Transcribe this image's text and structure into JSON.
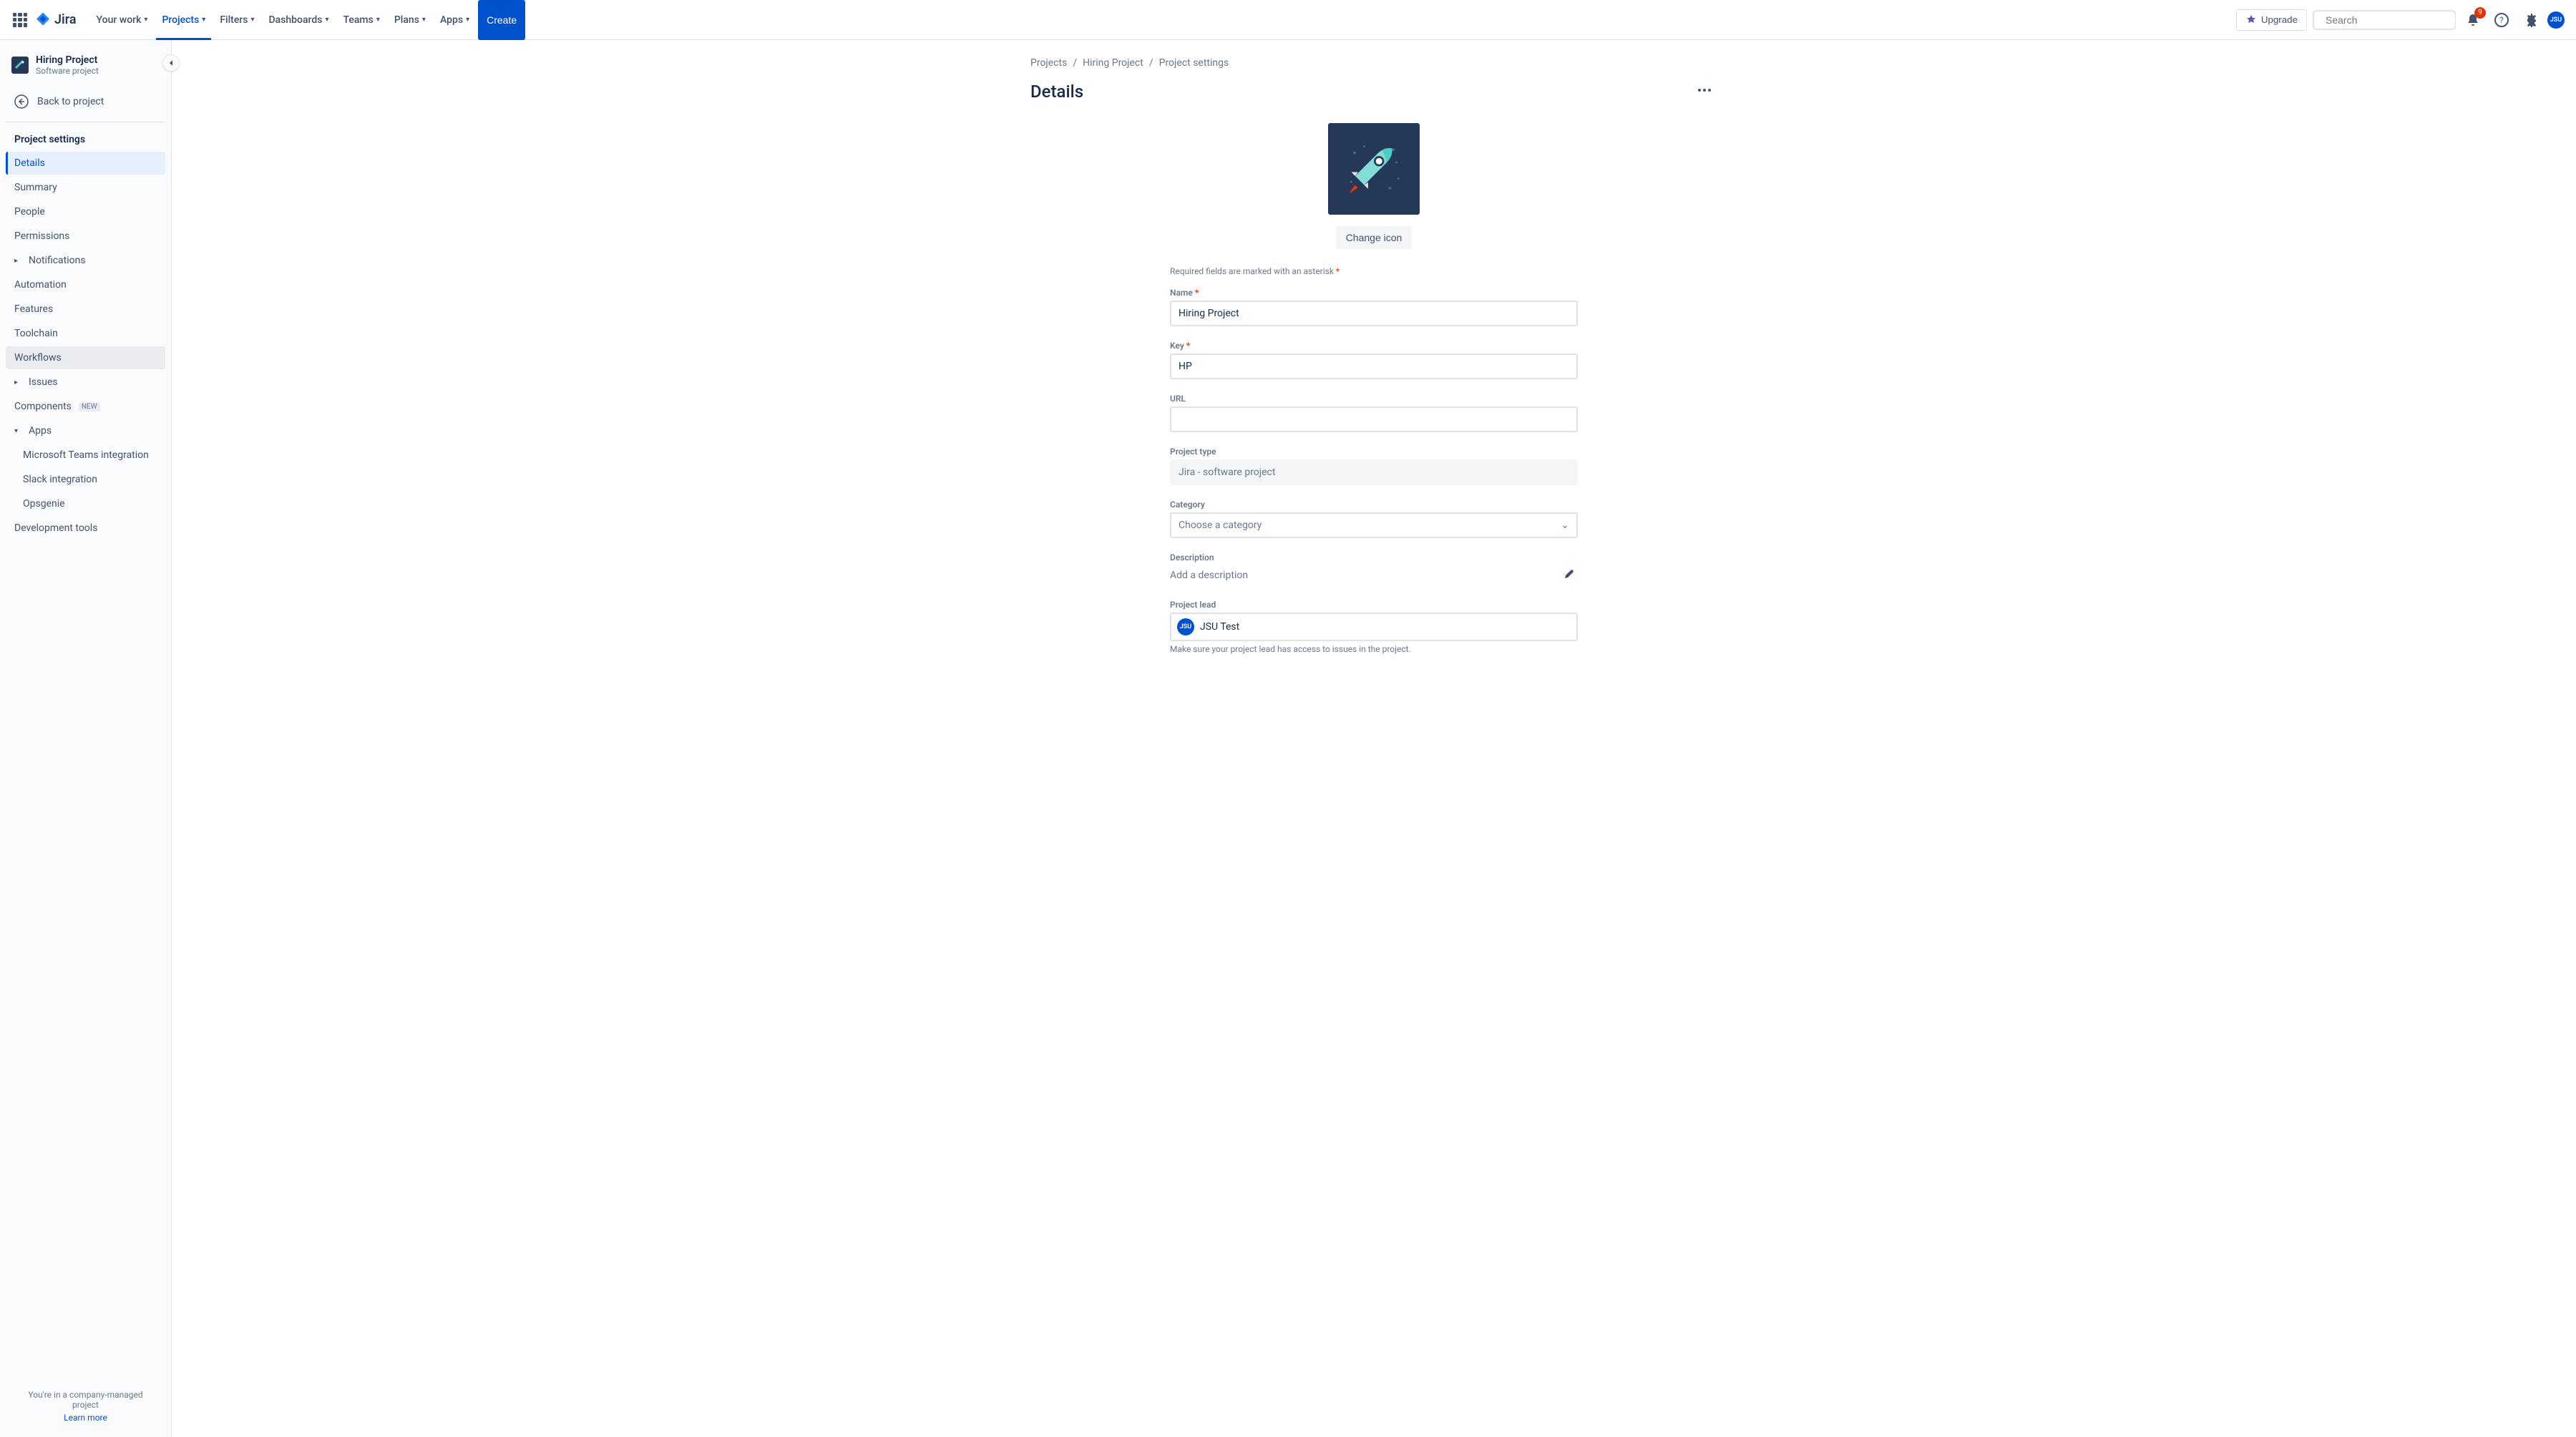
{
  "header": {
    "logo_text": "Jira",
    "nav": [
      "Your work",
      "Projects",
      "Filters",
      "Dashboards",
      "Teams",
      "Plans",
      "Apps"
    ],
    "active_nav": "Projects",
    "create": "Create",
    "upgrade": "Upgrade",
    "search_placeholder": "Search",
    "notification_count": "9",
    "avatar_initials": "JSU"
  },
  "sidebar": {
    "project_name": "Hiring Project",
    "project_type": "Software project",
    "back_label": "Back to project",
    "section_title": "Project settings",
    "items": {
      "details": "Details",
      "summary": "Summary",
      "people": "People",
      "permissions": "Permissions",
      "notifications": "Notifications",
      "automation": "Automation",
      "features": "Features",
      "toolchain": "Toolchain",
      "workflows": "Workflows",
      "issues": "Issues",
      "components": "Components",
      "components_badge": "NEW",
      "apps": "Apps",
      "teams_integration": "Microsoft Teams integration",
      "slack_integration": "Slack integration",
      "opsgenie": "Opsgenie",
      "dev_tools": "Development tools"
    },
    "footer_text": "You're in a company-managed project",
    "learn_more": "Learn more"
  },
  "breadcrumb": {
    "projects": "Projects",
    "project": "Hiring Project",
    "settings": "Project settings"
  },
  "page": {
    "title": "Details",
    "change_icon": "Change icon",
    "required_note": "Required fields are marked with an asterisk",
    "labels": {
      "name": "Name",
      "key": "Key",
      "url": "URL",
      "project_type": "Project type",
      "category": "Category",
      "description": "Description",
      "project_lead": "Project lead"
    },
    "values": {
      "name": "Hiring Project",
      "key": "HP",
      "url": "",
      "project_type": "Jira - software project",
      "category_placeholder": "Choose a category",
      "description_placeholder": "Add a description",
      "lead_name": "JSU Test",
      "lead_initials": "JSU"
    },
    "lead_help": "Make sure your project lead has access to issues in the project."
  }
}
